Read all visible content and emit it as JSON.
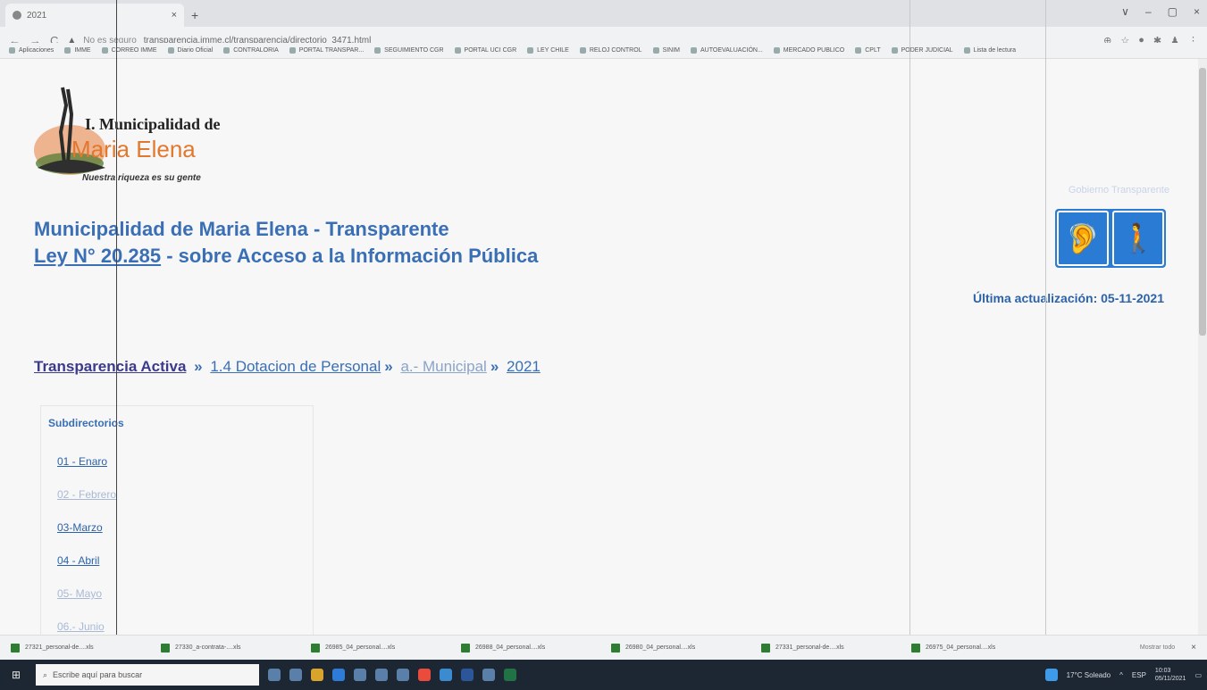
{
  "browser": {
    "tab_title": "2021",
    "tab_close": "×",
    "new_tab": "+",
    "window_controls": [
      "∨",
      "–",
      "▢",
      "×"
    ],
    "security_label": "No es seguro",
    "url": "transparencia.imme.cl/transparencia/directorio_3471.html",
    "bookmarks": [
      "Aplicaciones",
      "IMME",
      "CORREO IMME",
      "Diario Oficial",
      "CONTRALORIA",
      "PORTAL TRANSPAR...",
      "SEGUIMIENTO CGR",
      "PORTAL UCI CGR",
      "LEY CHILE",
      "RELOJ CONTROL",
      "SINIM",
      "AUTOEVALUACIÓN...",
      "MERCADO PUBLICO",
      "CPLT",
      "PODER JUDICIAL",
      "Lista de lectura"
    ]
  },
  "logo": {
    "title": "I. Municipalidad de",
    "name": "Maria Elena",
    "tagline": "Nuestra riqueza es su gente"
  },
  "header": {
    "government_label": "Gobierno Transparente",
    "title_line1": "Municipalidad de Maria Elena - Transparente",
    "title_line2_link": "Ley N° 20.285",
    "title_line2_rest": " - sobre Acceso a la Información Pública",
    "last_update": "Última actualización: 05-11-2021"
  },
  "breadcrumb": {
    "items": [
      "Transparencia Activa",
      "1.4 Dotacion de Personal",
      "a.- Municipal",
      "2021"
    ],
    "separator": "»"
  },
  "subdirectories": {
    "title": "Subdirectorios",
    "items": [
      "01 - Enaro",
      "02 - Febrero",
      "03-Marzo",
      "04 - Abril",
      "05- Mayo",
      "06.- Junio"
    ]
  },
  "downloads": {
    "files": [
      "27321_personal-de....xls",
      "27330_a-contrata-....xls",
      "26985_04_personal....xls",
      "26988_04_personal....xls",
      "26980_04_personal....xls",
      "27331_personal-de....xls",
      "26975_04_personal....xls"
    ],
    "show_all": "Mostrar todo",
    "close": "×"
  },
  "taskbar": {
    "search_placeholder": "Escribe aquí para buscar",
    "weather": "17°C Soleado",
    "lang": "ESP",
    "time": "10:03",
    "date": "05/11/2021"
  }
}
